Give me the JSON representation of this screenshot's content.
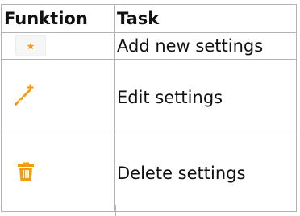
{
  "table": {
    "headers": {
      "function": "Funktion",
      "task": "Task"
    },
    "rows": [
      {
        "icon": "star-icon",
        "task": "Add new settings"
      },
      {
        "icon": "pencil-plus-icon",
        "task": "Edit settings"
      },
      {
        "icon": "trash-icon",
        "task": "Delete settings"
      }
    ]
  },
  "colors": {
    "icon_accent": "#f39c12",
    "border": "#b3b3b3"
  }
}
